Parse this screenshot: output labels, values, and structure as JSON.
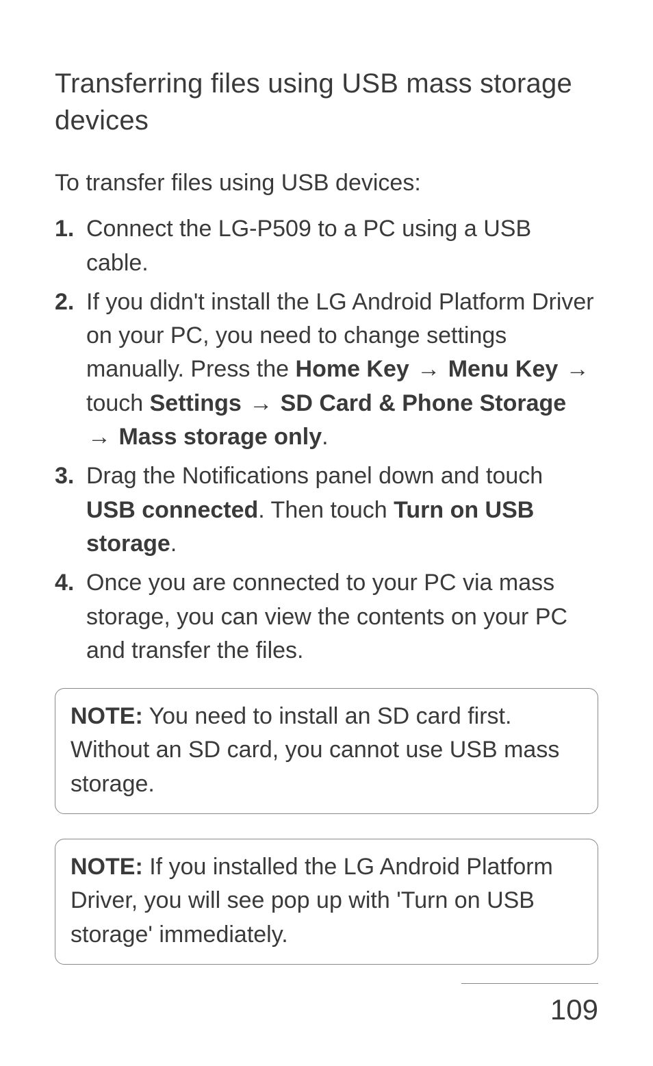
{
  "section_title": "Transferring files using USB mass storage devices",
  "sub_heading": "To transfer files using USB devices:",
  "steps": {
    "s1": "Connect the LG-P509 to a PC using a USB cable.",
    "s2_pre": "If you didn't install the LG Android Platform Driver on your PC, you need to change settings manually. Press the ",
    "s2_home": "Home Key",
    "s2_menu": "Menu Key",
    "s2_touch": " touch ",
    "s2_settings": "Settings",
    "s2_sd": "SD Card & Phone Storage",
    "s2_mass": "Mass storage only",
    "s3_pre": "Drag the Notifications panel down and touch ",
    "s3_usb_connected": "USB connected",
    "s3_mid": ". Then touch ",
    "s3_turn_on": "Turn on USB storage",
    "s4": "Once you are connected to your PC via mass storage, you can view the contents on your PC and transfer the files."
  },
  "note1_label": "NOTE:",
  "note1_body": " You need to install an SD card first. Without an SD card, you cannot use USB mass storage.",
  "note2_label": "NOTE:",
  "note2_body": " If you installed the LG Android Platform Driver, you will see pop up with 'Turn on USB storage' immediately.",
  "arrow": "→",
  "page_number": "109"
}
